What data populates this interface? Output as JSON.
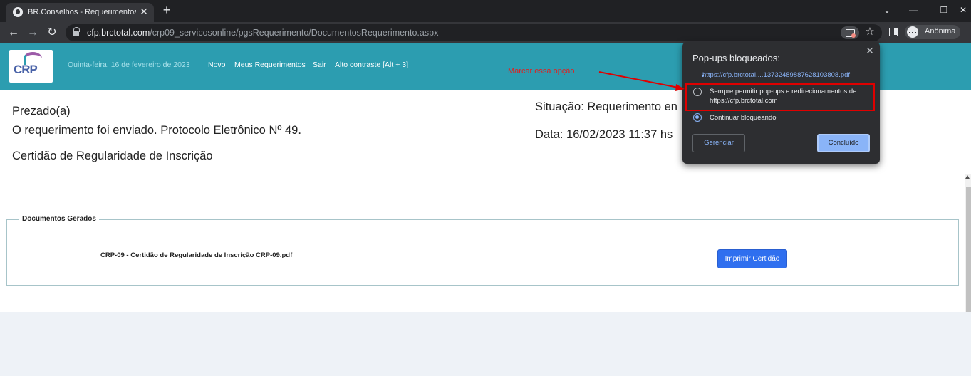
{
  "browser": {
    "tab_title": "BR.Conselhos - Requerimentos O",
    "tab_close": "✕",
    "new_tab": "+",
    "url_host": "cfp.brctotal.com",
    "url_path": "/crp09_servicosonline/pgsRequerimento/DocumentosRequerimento.aspx",
    "profile_label": "Anônima",
    "icons": [
      "back-icon",
      "forward-icon",
      "reload-icon",
      "lock-icon",
      "popup-blocked-icon",
      "star-icon",
      "side-panel-icon",
      "incognito-icon"
    ]
  },
  "header": {
    "logo_text": "CRP",
    "date": "Quinta-feira, 16 de fevereiro de 2023",
    "links": [
      "Novo",
      "Meus Requerimentos",
      "Sair",
      "Alto contraste [Alt + 3]"
    ]
  },
  "content": {
    "greeting": "Prezado(a)",
    "message": "O requerimento foi enviado. Protocolo Eletrônico Nº 49.",
    "service": "Certidão de Regularidade de Inscrição",
    "situation": "Situação: Requerimento en",
    "date": "Data: 16/02/2023 11:37 hs"
  },
  "documents": {
    "legend": "Documentos Gerados",
    "file_name": "CRP-09 - Certidão de Regularidade de Inscrição CRP-09.pdf",
    "print_button": "Imprimir Certidão"
  },
  "popup_bubble": {
    "title": "Pop-ups bloqueados:",
    "blocked_link": "https://cfp.brctotal....1373248988762810380​8.pdf",
    "option_allow": "Sempre permitir pop-ups e redirecionamentos de https://cfp.brctotal.com",
    "option_block": "Continuar bloqueando",
    "selected_option": "block",
    "manage_button": "Gerenciar",
    "done_button": "Concluído"
  },
  "annotation": {
    "text": "Marcar essa opção",
    "color": "#e02020"
  }
}
